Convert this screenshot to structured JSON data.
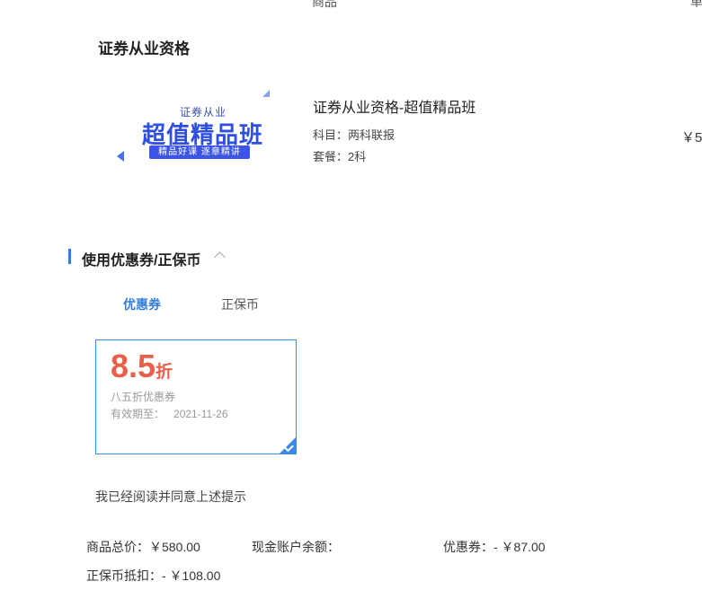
{
  "cutoff": {
    "left_text": "商品",
    "right_text": "单"
  },
  "section": {
    "title": "证券从业资格"
  },
  "banner": {
    "sub": "证券从业",
    "main": "超值精品班",
    "tagline": "精品好课 逐章精讲"
  },
  "product": {
    "title": "证券从业资格-超值精品班",
    "subject_label": "科目：",
    "subject_value": "两科联报",
    "package_label": "套餐：",
    "package_value": "2科",
    "price_cut": "￥5"
  },
  "coupon_section": {
    "title": "使用优惠券/正保币",
    "tabs": [
      {
        "label": "优惠券",
        "active": true
      },
      {
        "label": "正保币",
        "active": false
      }
    ],
    "coupon": {
      "rate": "8.5",
      "unit": "折",
      "name": "八五折优惠券",
      "expire_label": "有效期至：",
      "expire_date": "2021-11-26",
      "selected": true
    }
  },
  "agreement": "我已经阅读并同意上述提示",
  "summary": {
    "total_label": "商品总价：",
    "total_value": "￥580.00",
    "balance_label": "现金账户余额：",
    "coupon_label": "优惠券：",
    "coupon_value": "- ￥87.00",
    "coin_label": "正保币抵扣：",
    "coin_value": "- ￥108.00"
  },
  "colors": {
    "accent": "#2f7de1",
    "coupon_red": "#e8604a",
    "banner_blue": "#2f4fe0"
  }
}
